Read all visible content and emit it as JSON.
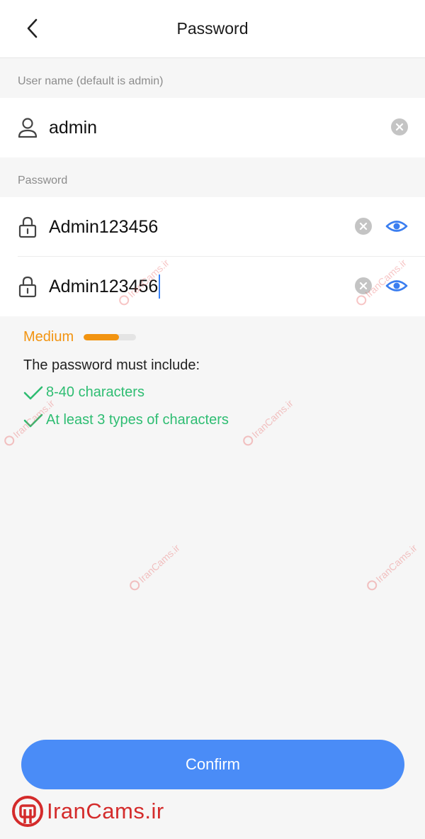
{
  "header": {
    "title": "Password",
    "back_icon": "chevron-left-icon"
  },
  "username_section": {
    "label": "User name (default is admin)",
    "value": "admin",
    "icon": "user-icon"
  },
  "password_section": {
    "label": "Password",
    "password_value": "Admin123456",
    "confirm_value": "Admin123456",
    "icon": "lock-icon"
  },
  "strength": {
    "label": "Medium",
    "level": 0.68,
    "color": "#f29411"
  },
  "requirements": {
    "title": "The password must include:",
    "items": [
      "8-40 characters",
      "At least 3 types of characters"
    ],
    "color": "#2ebd72"
  },
  "confirm_button": {
    "label": "Confirm",
    "color": "#4a8cf7"
  },
  "watermark": {
    "text": "IranCams.ir",
    "brand_text": "IranCams.ir",
    "color": "#d42b2b"
  }
}
